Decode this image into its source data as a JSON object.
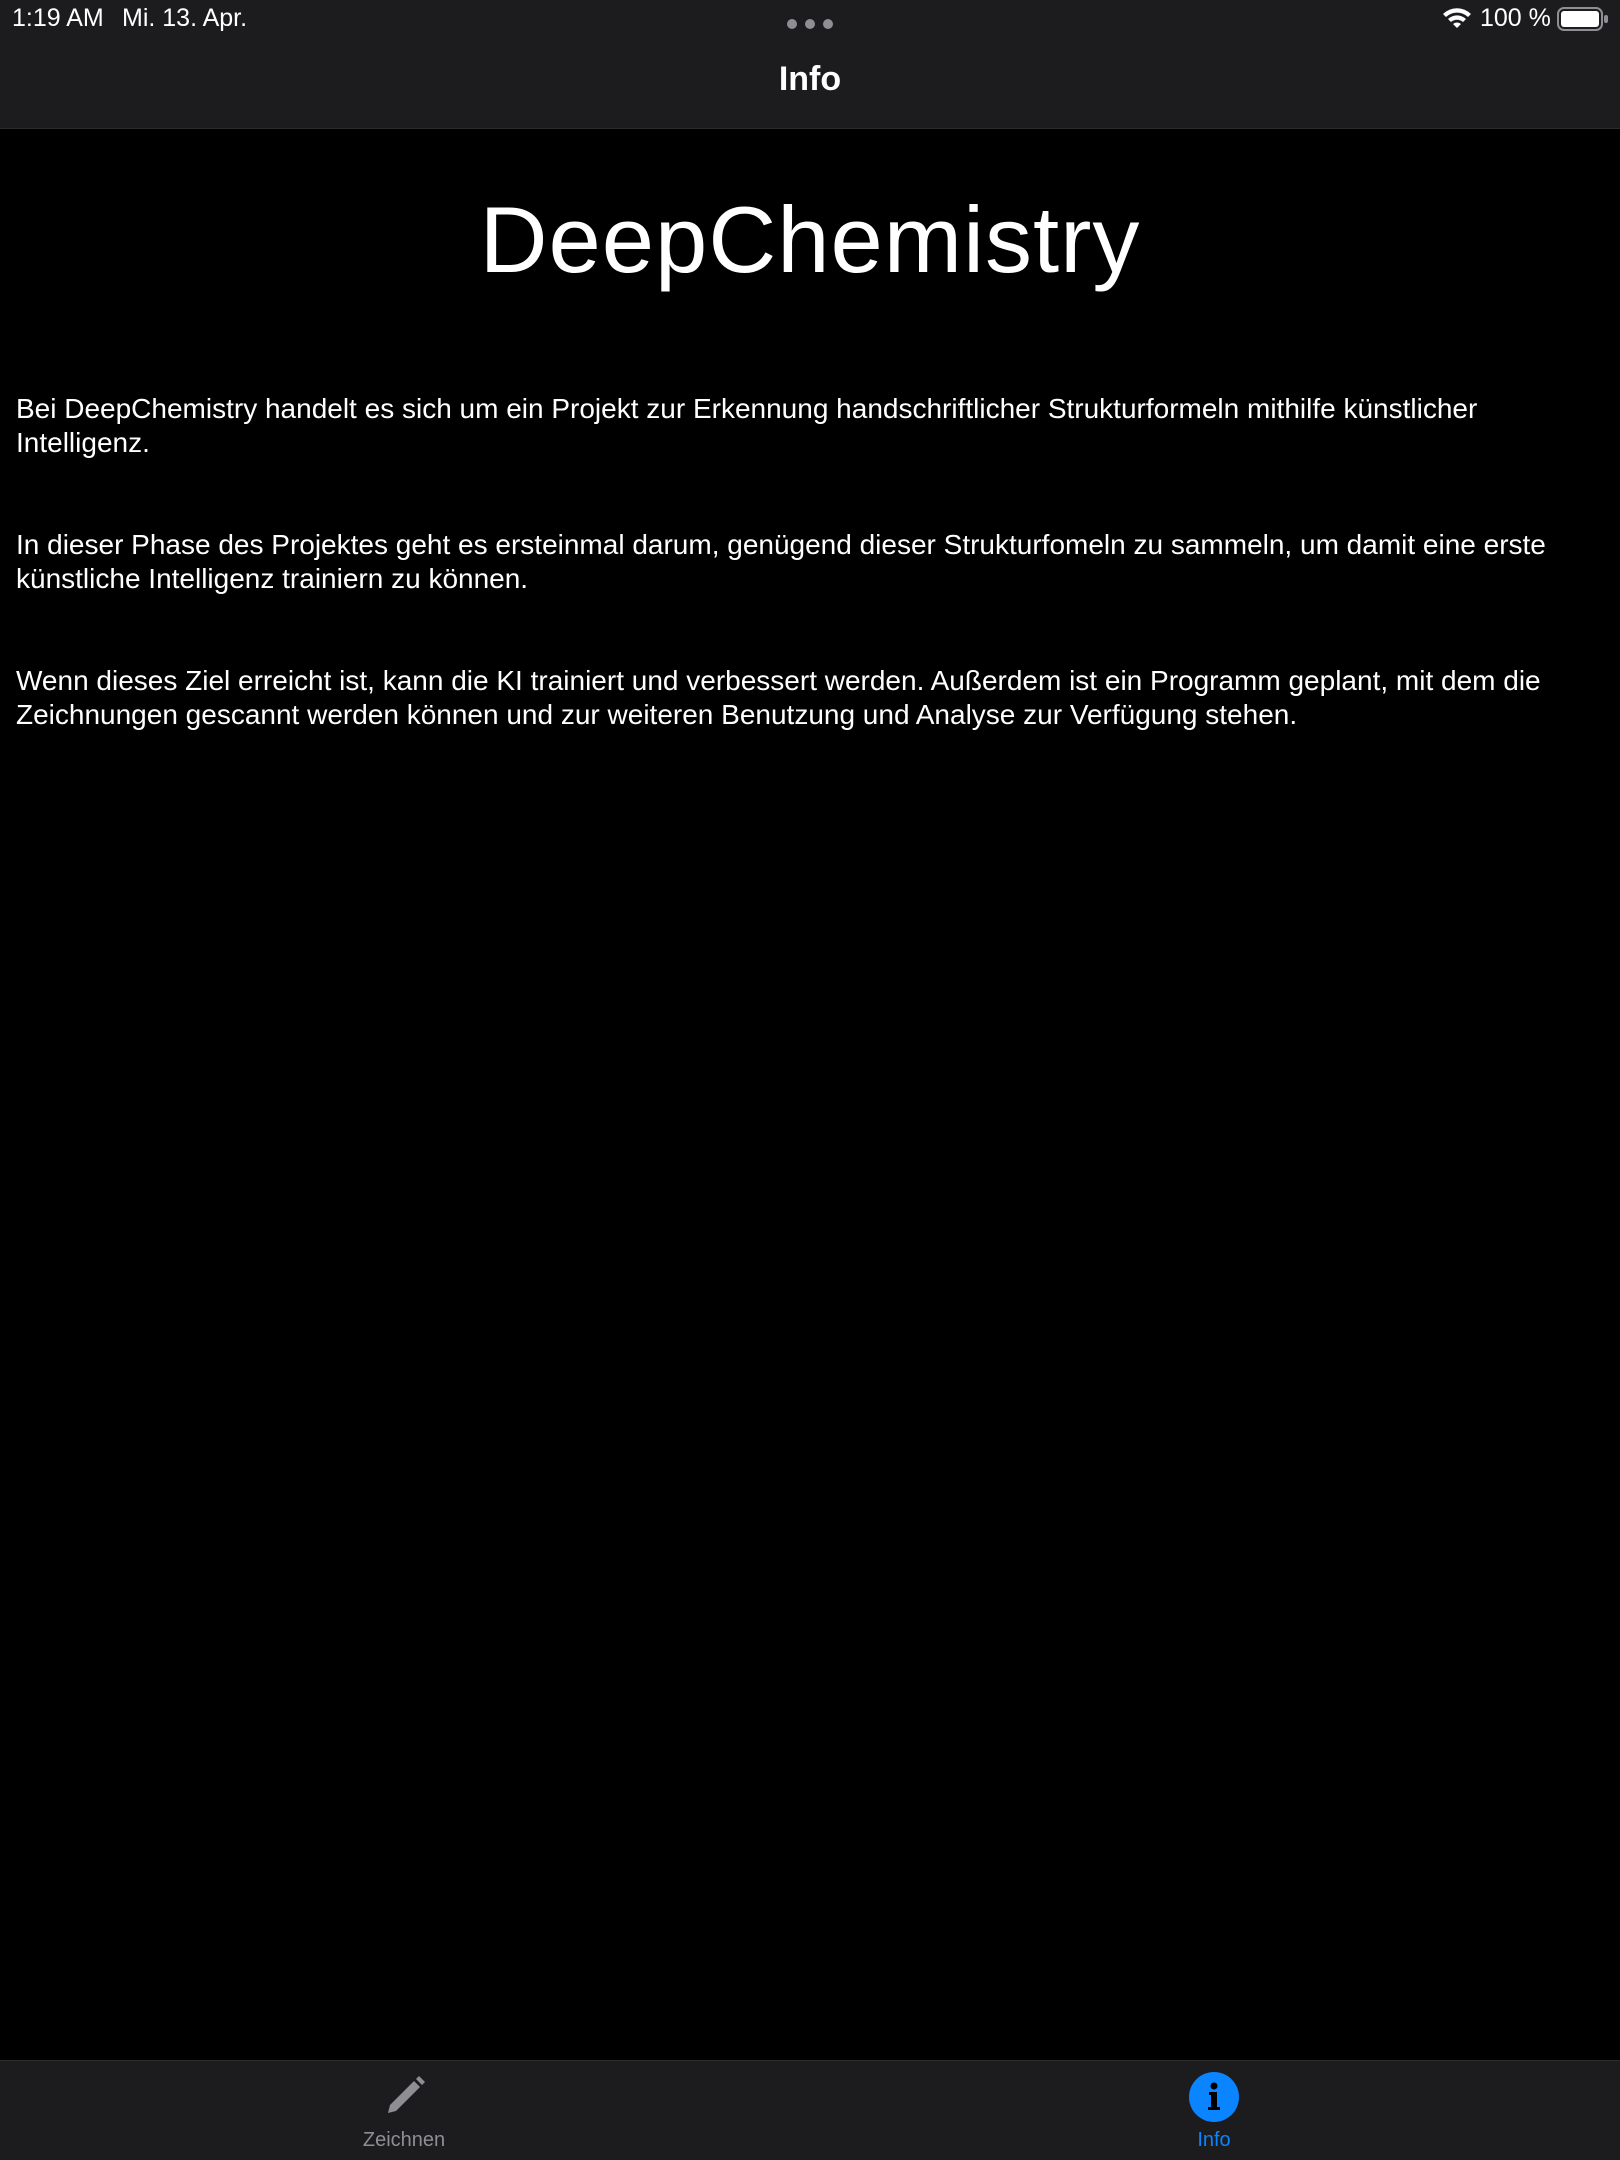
{
  "status_bar": {
    "time": "1:19 AM",
    "date": "Mi. 13. Apr.",
    "battery_percent": "100 %",
    "battery_level": 1.0
  },
  "nav": {
    "title": "Info"
  },
  "content": {
    "app_title": "DeepChemistry",
    "paragraphs": [
      "Bei DeepChemistry handelt es sich um ein Projekt zur Erkennung handschriftlicher Strukturformeln mithilfe künstlicher Intelligenz.",
      "In dieser Phase des Projektes geht es ersteinmal darum, genügend dieser Strukturfomeln zu sammeln, um damit eine erste künstliche Intelligenz trainiern zu können.",
      "Wenn dieses Ziel erreicht ist, kann die KI trainiert und verbessert werden. Außerdem ist ein Programm geplant, mit dem die Zeichnungen gescannt werden können und zur weiteren Benutzung und Analyse zur Verfügung stehen."
    ]
  },
  "tab_bar": {
    "tabs": [
      {
        "label": "Zeichnen",
        "icon": "pencil-icon",
        "selected": false
      },
      {
        "label": "Info",
        "icon": "info-circle-icon",
        "selected": true
      }
    ]
  },
  "colors": {
    "background": "#000000",
    "bar_background": "#1c1c1e",
    "accent": "#0a84ff",
    "inactive": "#8e8e93",
    "text": "#ffffff"
  }
}
